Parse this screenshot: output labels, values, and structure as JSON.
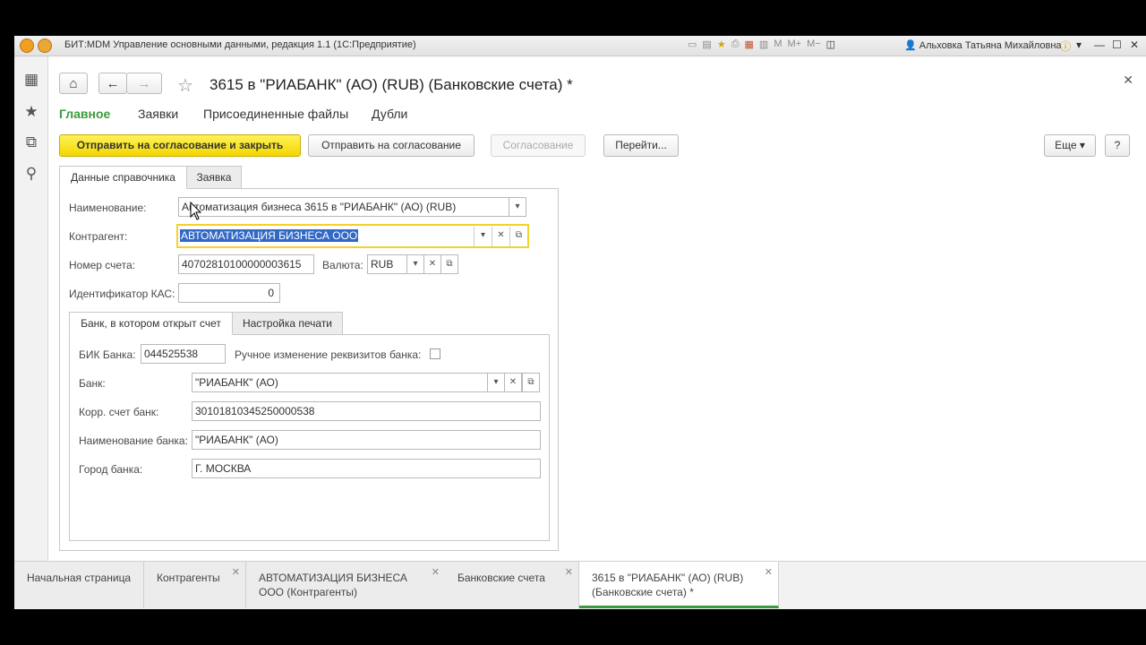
{
  "window": {
    "title": "БИТ:MDM Управление основными данными, редакция 1.1  (1С:Предприятие)",
    "user": "Альховка Татьяна Михайловна",
    "toolbar_icons": [
      "copy-icon",
      "paste-icon",
      "favorite-icon",
      "print-icon",
      "calendar-icon",
      "calc-icon",
      "m-icon",
      "m-plus-icon",
      "m-minus-icon",
      "panel-icon"
    ]
  },
  "sidebar": [
    "apps-grid-icon",
    "favorites-star-icon",
    "history-icon",
    "search-icon"
  ],
  "form": {
    "title": "3615 в \"РИАБАНК\" (АО) (RUB) (Банковские счета) *",
    "menu": [
      "Главное",
      "Заявки",
      "Присоединенные файлы",
      "Дубли"
    ],
    "buttons": {
      "send_close": "Отправить на согласование и закрыть",
      "send": "Отправить на согласование",
      "approval": "Согласование",
      "goto": "Перейти...",
      "more": "Еще",
      "help": "?"
    },
    "tabs": [
      "Данные справочника",
      "Заявка"
    ],
    "fields": {
      "name_label": "Наименование:",
      "name_value": "Автоматизация бизнеса 3615 в \"РИАБАНК\" (АО) (RUB)",
      "contractor_label": "Контрагент:",
      "contractor_value": "АВТОМАТИЗАЦИЯ БИЗНЕСА ООО",
      "account_label": "Номер счета:",
      "account_value": "40702810100000003615",
      "currency_label": "Валюта:",
      "currency_value": "RUB",
      "kas_label": "Идентификатор КАС:",
      "kas_value": "0"
    },
    "bank_tabs": [
      "Банк, в котором открыт счет",
      "Настройка печати"
    ],
    "bank": {
      "bik_label": "БИК Банка:",
      "bik_value": "044525538",
      "manual_label": "Ручное изменение реквизитов банка:",
      "bank_label": "Банк:",
      "bank_value": "\"РИАБАНК\" (АО)",
      "corr_label": "Корр. счет банк:",
      "corr_value": "30101810345250000538",
      "bankname_label": "Наименование банка:",
      "bankname_value": "\"РИАБАНК\" (АО)",
      "city_label": "Город банка:",
      "city_value": "Г. МОСКВА"
    }
  },
  "bottom_tabs": [
    {
      "label": "Начальная страница",
      "closable": false
    },
    {
      "label": "Контрагенты",
      "closable": true
    },
    {
      "label": "АВТОМАТИЗАЦИЯ БИЗНЕСА ООО (Контрагенты)",
      "closable": true
    },
    {
      "label": "Банковские счета",
      "closable": true
    },
    {
      "label": "3615 в \"РИАБАНК\" (АО) (RUB) (Банковские счета) *",
      "closable": true
    }
  ],
  "colors": {
    "accent_green": "#3c9b3c",
    "primary_yellow": "#f2d600",
    "selection_blue": "#3169c6"
  }
}
